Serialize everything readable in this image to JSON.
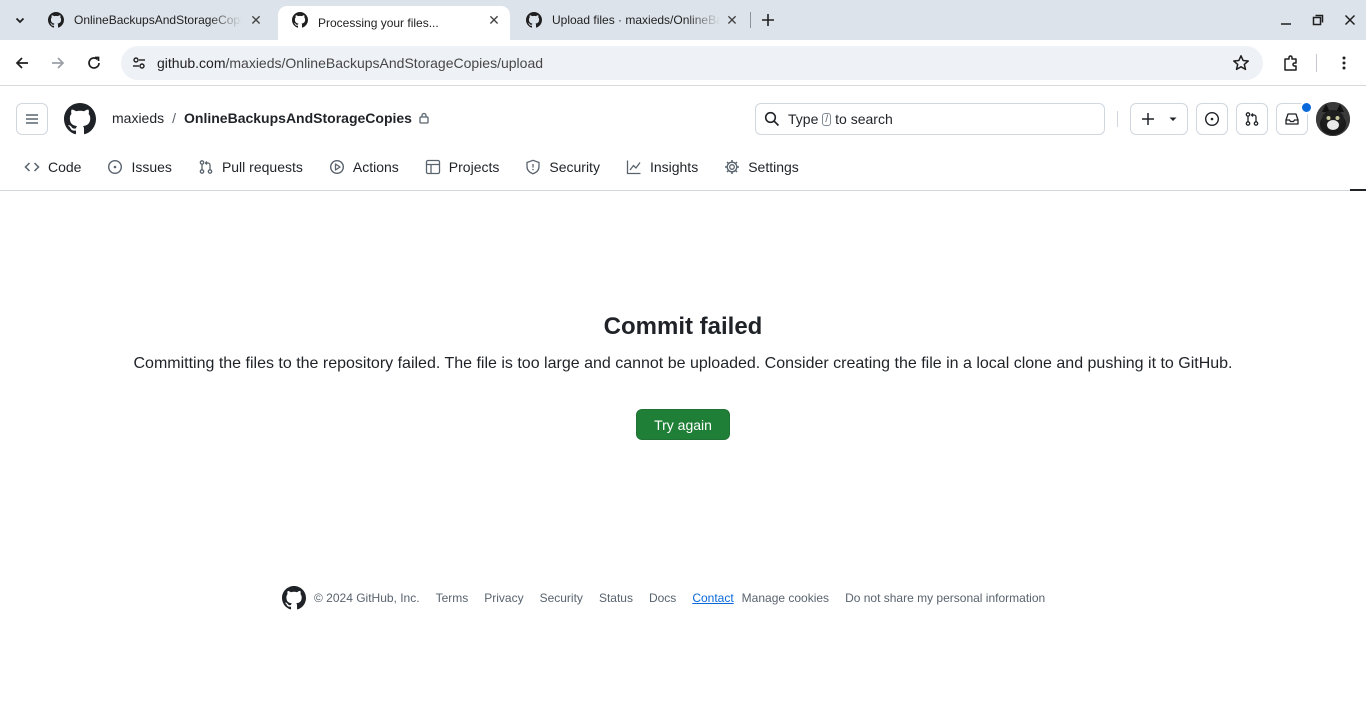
{
  "browser": {
    "tabs": [
      {
        "title": "OnlineBackupsAndStorageCopies",
        "active": false
      },
      {
        "title": "Processing your files...",
        "active": true
      },
      {
        "title": "Upload files · maxieds/OnlineBackupsAndStorageCopies",
        "active": false
      }
    ],
    "url_host": "github.com",
    "url_path": "/maxieds/OnlineBackupsAndStorageCopies/upload"
  },
  "header": {
    "owner": "maxieds",
    "separator": "/",
    "repo": "OnlineBackupsAndStorageCopies",
    "search_prefix": "Type",
    "search_key": "/",
    "search_suffix": "to search",
    "notification_color": "#0969da"
  },
  "repo_nav": [
    {
      "label": "Code",
      "icon": "code-icon"
    },
    {
      "label": "Issues",
      "icon": "issue-opened-icon"
    },
    {
      "label": "Pull requests",
      "icon": "git-pull-request-icon"
    },
    {
      "label": "Actions",
      "icon": "play-icon"
    },
    {
      "label": "Projects",
      "icon": "table-icon"
    },
    {
      "label": "Security",
      "icon": "shield-icon"
    },
    {
      "label": "Insights",
      "icon": "graph-icon"
    },
    {
      "label": "Settings",
      "icon": "gear-icon"
    }
  ],
  "main": {
    "title": "Commit failed",
    "message": "Committing the files to the repository failed. The file is too large and cannot be uploaded. Consider creating the file in a local clone and pushing it to GitHub.",
    "button": "Try again",
    "button_color": "#1f7f37"
  },
  "footer": {
    "copyright": "© 2024 GitHub, Inc.",
    "links": [
      "Terms",
      "Privacy",
      "Security",
      "Status",
      "Docs",
      "Contact",
      "Manage cookies",
      "Do not share my personal information"
    ]
  }
}
